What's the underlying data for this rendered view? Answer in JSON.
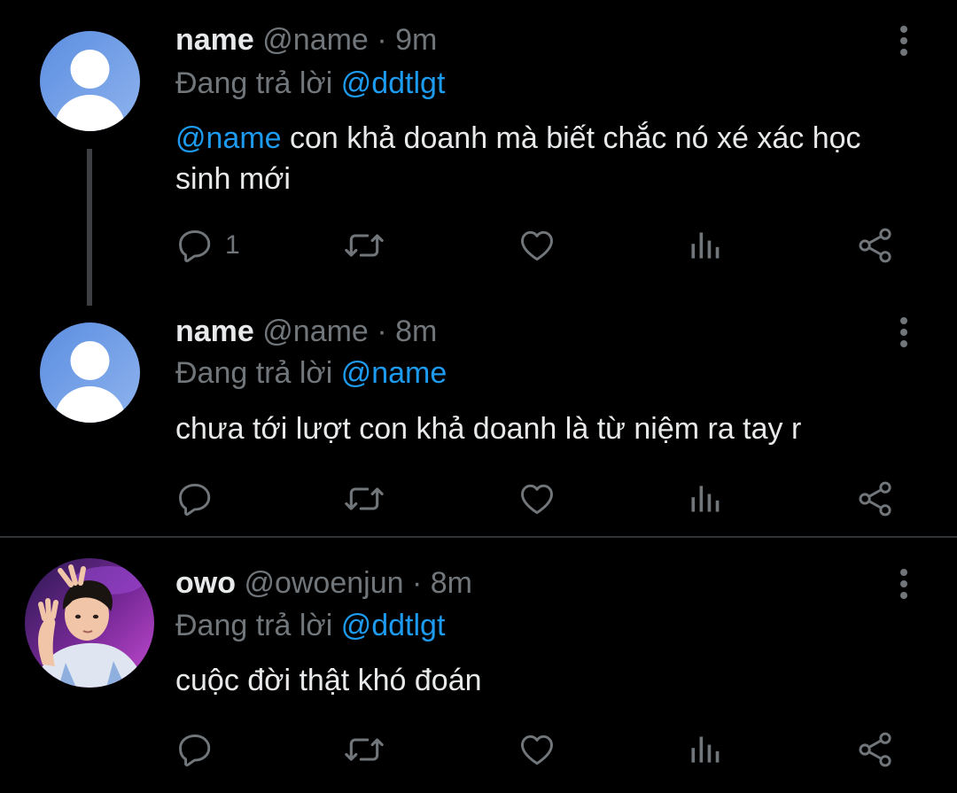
{
  "tweets": [
    {
      "name": "name",
      "handle": "@name",
      "time": "9m",
      "reply_prefix": "Đang trả lời",
      "reply_to": "@ddtlgt",
      "body_mention": "@name",
      "body_text": " con khả doanh mà biết chắc nó xé xác học sinh mới",
      "reply_count": "1",
      "avatar": "default-avatar-icon"
    },
    {
      "name": "name",
      "handle": "@name",
      "time": "8m",
      "reply_prefix": "Đang trả lời",
      "reply_to": "@name",
      "body_mention": "",
      "body_text": "chưa tới lượt con khả doanh là từ niệm ra tay r",
      "reply_count": "",
      "avatar": "default-avatar-icon"
    },
    {
      "name": "owo",
      "handle": "@owoenjun",
      "time": "8m",
      "reply_prefix": "Đang trả lời",
      "reply_to": "@ddtlgt",
      "body_mention": "",
      "body_text": "cuộc đời thật khó đoán",
      "reply_count": "",
      "avatar": "profile-photo"
    }
  ],
  "separator": "·",
  "colors": {
    "background": "#000000",
    "primary_text": "#e7e9ea",
    "secondary_text": "#71767b",
    "link": "#1d9bf0",
    "divider": "#2f3336"
  },
  "icons": [
    "reply-icon",
    "retweet-icon",
    "like-icon",
    "views-icon",
    "share-icon",
    "more-icon"
  ]
}
